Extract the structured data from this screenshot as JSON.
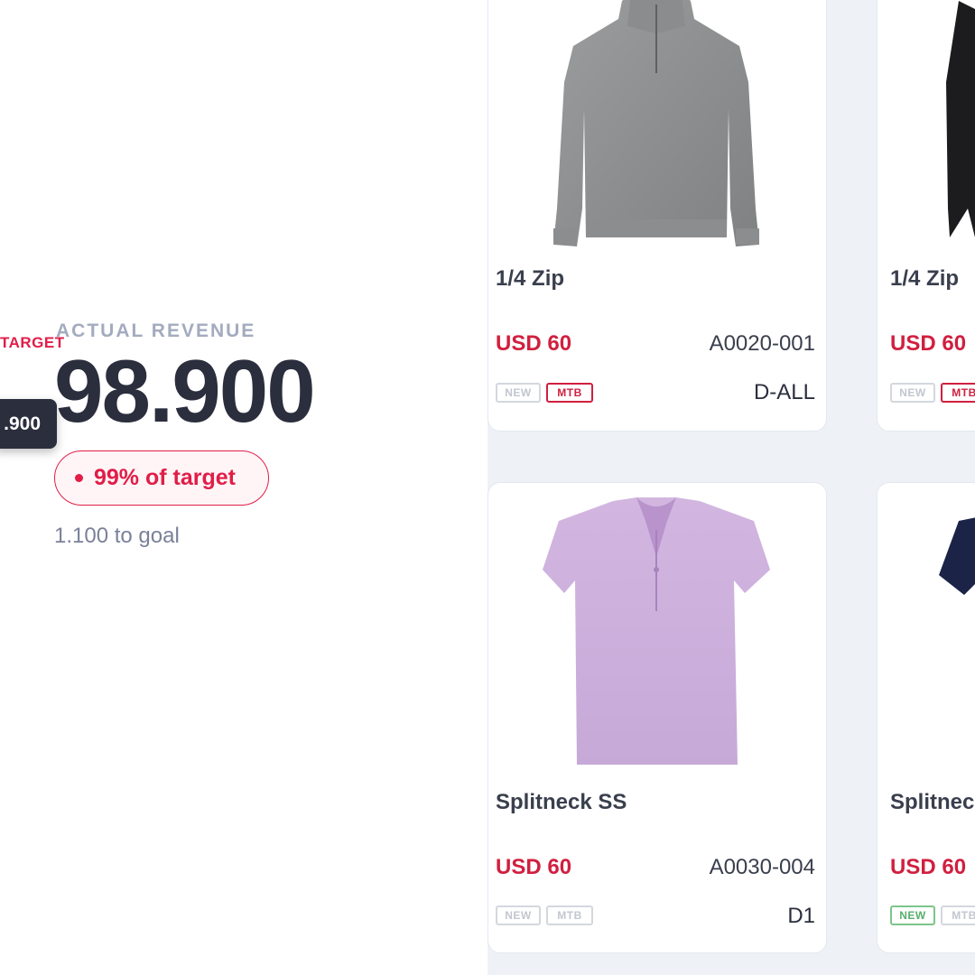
{
  "summary": {
    "target_label": "TARGET",
    "eyebrow": "ACTUAL REVENUE",
    "value": "98.900",
    "tooltip_value": ".900",
    "target_pill": "99% of target",
    "to_goal": "1.100 to goal"
  },
  "colors": {
    "accent_red": "#e11d48",
    "dark": "#2b2e3d",
    "grid_bg": "#eef2f7"
  },
  "products": [
    {
      "name": "1/4 Zip",
      "price": "USD 60",
      "sku": "A0020-001",
      "drop": "D-ALL",
      "tags": [
        {
          "label": "NEW",
          "style": "muted"
        },
        {
          "label": "MTB",
          "style": "red"
        }
      ],
      "image": "grey-quarter-zip-sweater"
    },
    {
      "name": "1/4 Zip",
      "price": "USD 60",
      "tags": [
        {
          "label": "NEW",
          "style": "muted"
        },
        {
          "label": "MTB",
          "style": "red"
        }
      ],
      "image": "black-quarter-zip-sweater"
    },
    {
      "name": "Splitneck SS",
      "price": "USD 60",
      "sku": "A0030-004",
      "drop": "D1",
      "tags": [
        {
          "label": "NEW",
          "style": "muted"
        },
        {
          "label": "MTB",
          "style": "muted"
        }
      ],
      "image": "lilac-splitneck-blouse"
    },
    {
      "name": "Splitneck SS",
      "price": "USD 60",
      "tags": [
        {
          "label": "NEW",
          "style": "green"
        },
        {
          "label": "MTB",
          "style": "muted"
        }
      ],
      "image": "navy-splitneck-blouse"
    }
  ]
}
